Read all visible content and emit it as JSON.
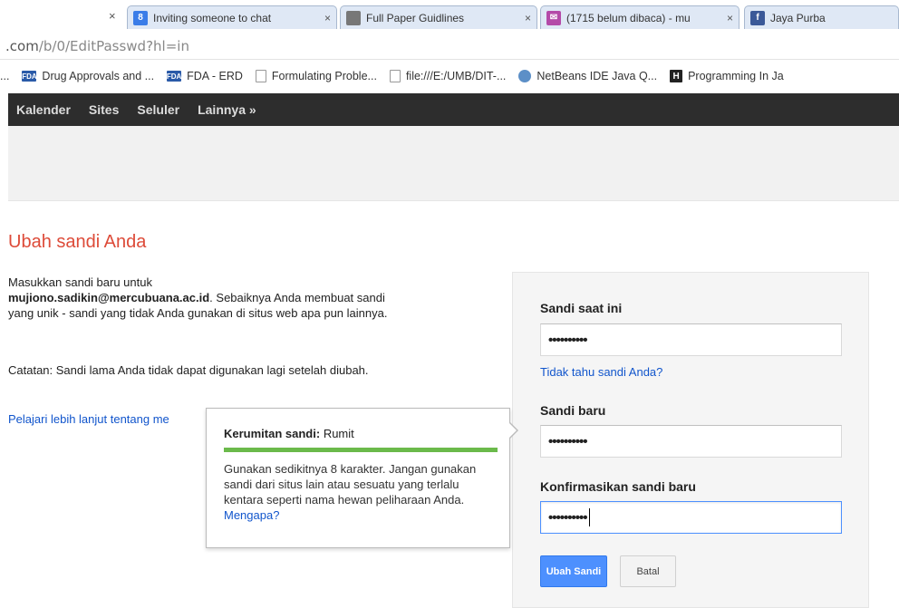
{
  "tabs": [
    {
      "label": "Inviting someone to chat",
      "close": "×",
      "icon": "google-plus-icon",
      "color": "#3b7de8"
    },
    {
      "label": "Full Paper Guidlines",
      "close": "×",
      "icon": "paper-icon",
      "color": "#777777"
    },
    {
      "label": "(1715 belum dibaca) - mu",
      "close": "×",
      "icon": "mail-icon",
      "color": "#b44aa8"
    },
    {
      "label": "Jaya Purba",
      "close": "",
      "icon": "facebook-icon",
      "color": "#3b5998"
    }
  ],
  "lone_close": "×",
  "address": {
    "host": ".com",
    "path": "/b/0/EditPasswd?hl=in"
  },
  "bookmarks": [
    {
      "label": "...",
      "icon": "none"
    },
    {
      "label": "Drug Approvals and ...",
      "icon": "fda-icon",
      "badge": "FDA"
    },
    {
      "label": "FDA - ERD",
      "icon": "fda-icon",
      "badge": "FDA"
    },
    {
      "label": "Formulating Proble...",
      "icon": "page-icon",
      "badge": ""
    },
    {
      "label": "file:///E:/UMB/DIT-...",
      "icon": "page-icon",
      "badge": ""
    },
    {
      "label": "NetBeans IDE Java Q...",
      "icon": "netbeans-icon",
      "badge": ""
    },
    {
      "label": "Programming In Ja",
      "icon": "h-icon",
      "badge": "H"
    }
  ],
  "gbar": [
    "Kalender",
    "Sites",
    "Seluler",
    "Lainnya »"
  ],
  "page": {
    "title": "Ubah sandi Anda",
    "intro_prefix": "Masukkan sandi baru untuk",
    "email": "mujiono.sadikin@mercubuana.ac.id",
    "intro_suffix": ". Sebaiknya Anda membuat sandi yang unik - sandi yang tidak Anda gunakan di situs web apa pun lainnya.",
    "note": "Catatan: Sandi lama Anda tidak dapat digunakan lagi setelah diubah.",
    "learn_link": "Pelajari lebih lanjut tentang me"
  },
  "form": {
    "current_label": "Sandi saat ini",
    "current_value": "••••••••••",
    "forgot_link": "Tidak tahu sandi Anda?",
    "new_label": "Sandi baru",
    "new_value": "••••••••••",
    "confirm_label": "Konfirmasikan sandi baru",
    "confirm_value": "••••••••••",
    "submit": "Ubah Sandi",
    "cancel": "Batal"
  },
  "strength": {
    "label": "Kerumitan sandi:",
    "value": "Rumit",
    "level": 1.0,
    "color": "#6bba4b",
    "tip": "Gunakan sedikitnya 8 karakter. Jangan gunakan sandi dari situs lain atau sesuatu yang terlalu kentara seperti nama hewan peliharaan Anda.",
    "why_link": "Mengapa?"
  }
}
